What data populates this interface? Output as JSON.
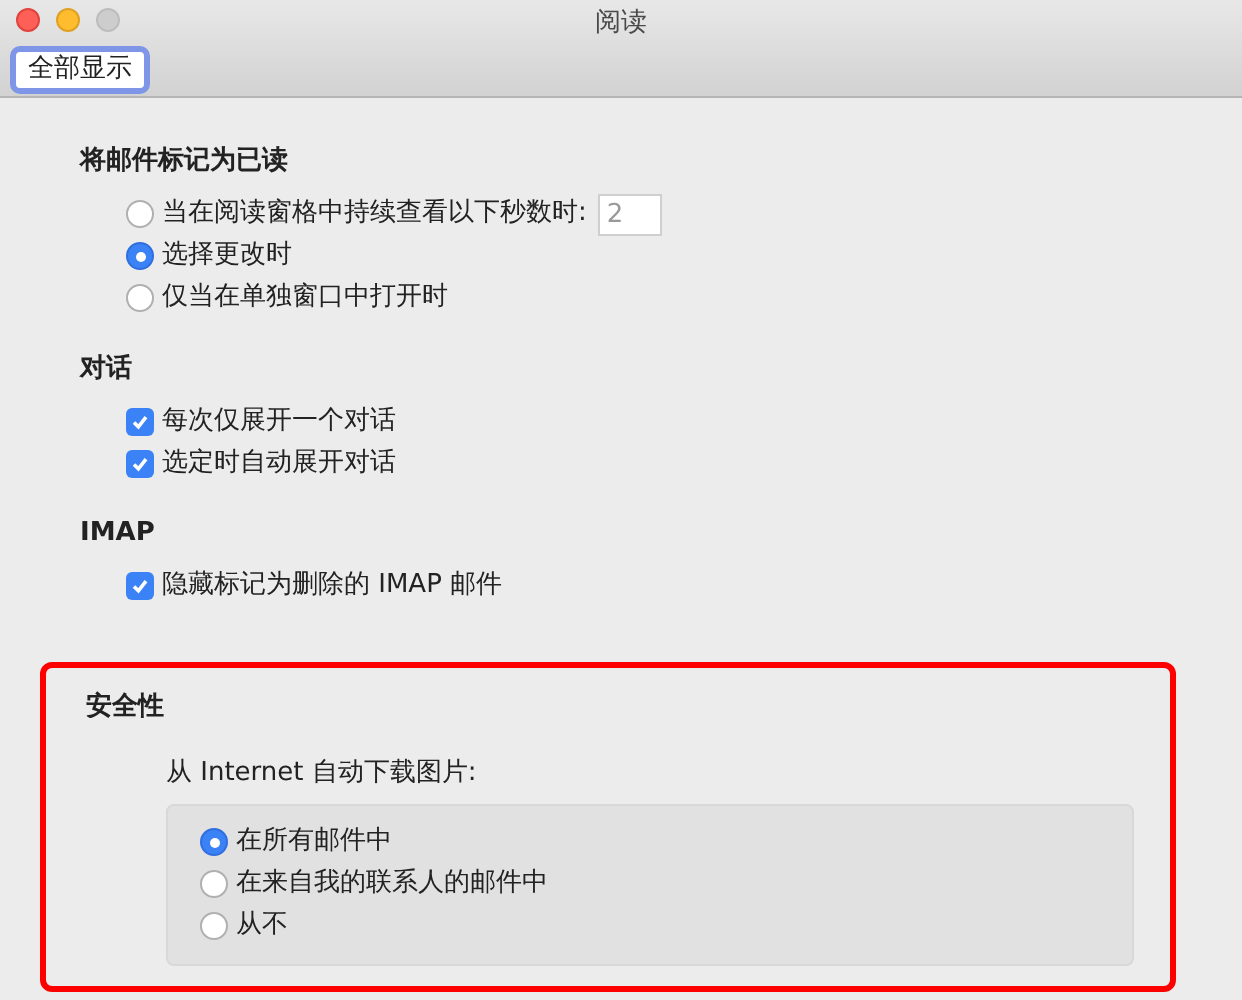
{
  "window": {
    "title": "阅读"
  },
  "toolbar": {
    "show_all_button": "全部显示"
  },
  "sections": [
    {
      "title": "将邮件标记为已读",
      "kind": "radio",
      "options": [
        {
          "label": "当在阅读窗格中持续查看以下秒数时:",
          "selected": false,
          "field_value": "2"
        },
        {
          "label": "选择更改时",
          "selected": true
        },
        {
          "label": "仅当在单独窗口中打开时",
          "selected": false
        }
      ]
    },
    {
      "title": "对话",
      "kind": "checkbox",
      "options": [
        {
          "label": "每次仅展开一个对话",
          "checked": true
        },
        {
          "label": "选定时自动展开对话",
          "checked": true
        }
      ]
    },
    {
      "title": "IMAP",
      "kind": "checkbox",
      "options": [
        {
          "label": "隐藏标记为删除的 IMAP 邮件",
          "checked": true
        }
      ]
    },
    {
      "title": "安全性",
      "kind": "grouped-radio",
      "highlighted": true,
      "subtitle": "从 Internet 自动下载图片:",
      "options": [
        {
          "label": "在所有邮件中",
          "selected": true
        },
        {
          "label": "在来自我的联系人的邮件中",
          "selected": false
        },
        {
          "label": "从不",
          "selected": false
        }
      ]
    }
  ]
}
